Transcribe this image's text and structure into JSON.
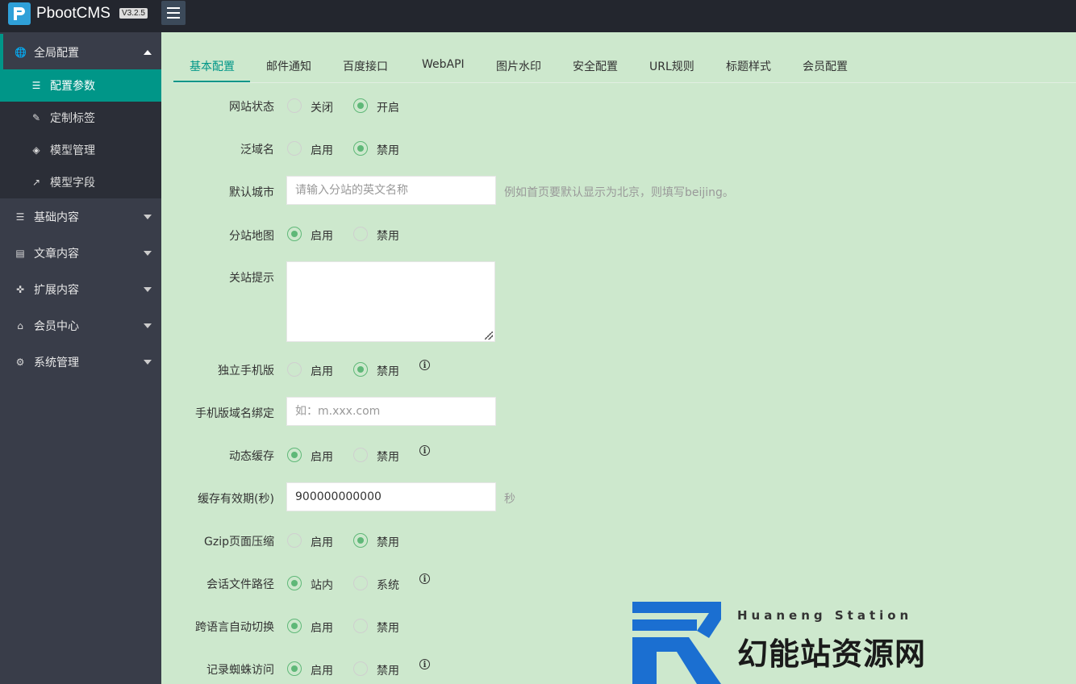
{
  "header": {
    "brand": "PbootCMS",
    "version": "V3.2.5"
  },
  "sidebar": {
    "groups": [
      {
        "label": "全局配置",
        "icon": "globe-icon"
      },
      {
        "label": "基础内容",
        "icon": "sliders-icon"
      },
      {
        "label": "文章内容",
        "icon": "file-icon"
      },
      {
        "label": "扩展内容",
        "icon": "expand-icon"
      },
      {
        "label": "会员中心",
        "icon": "lock-icon"
      },
      {
        "label": "系统管理",
        "icon": "gear-icon"
      }
    ],
    "subitems": [
      {
        "label": "配置参数",
        "icon": "sliders-icon"
      },
      {
        "label": "定制标签",
        "icon": "wrench-icon"
      },
      {
        "label": "模型管理",
        "icon": "cube-icon"
      },
      {
        "label": "模型字段",
        "icon": "external-link-icon"
      }
    ]
  },
  "tabs": [
    "基本配置",
    "邮件通知",
    "百度接口",
    "WebAPI",
    "图片水印",
    "安全配置",
    "URL规则",
    "标题样式",
    "会员配置"
  ],
  "form": {
    "site_status": {
      "label": "网站状态",
      "opt1": "关闭",
      "opt2": "开启"
    },
    "wildcard": {
      "label": "泛域名",
      "opt1": "启用",
      "opt2": "禁用"
    },
    "default_city": {
      "label": "默认城市",
      "placeholder": "请输入分站的英文名称",
      "hint": "例如首页要默认显示为北京，则填写beijing。"
    },
    "sub_map": {
      "label": "分站地图",
      "opt1": "启用",
      "opt2": "禁用"
    },
    "close_tip": {
      "label": "关站提示"
    },
    "mobile": {
      "label": "独立手机版",
      "opt1": "启用",
      "opt2": "禁用"
    },
    "mobile_domain": {
      "label": "手机版域名绑定",
      "placeholder": "如：m.xxx.com"
    },
    "cache": {
      "label": "动态缓存",
      "opt1": "启用",
      "opt2": "禁用"
    },
    "cache_time": {
      "label": "缓存有效期(秒)",
      "value": "900000000000",
      "unit": "秒"
    },
    "gzip": {
      "label": "Gzip页面压缩",
      "opt1": "启用",
      "opt2": "禁用"
    },
    "session_path": {
      "label": "会话文件路径",
      "opt1": "站内",
      "opt2": "系统"
    },
    "lang_switch": {
      "label": "跨语言自动切换",
      "opt1": "启用",
      "opt2": "禁用"
    },
    "spider_log": {
      "label": "记录蜘蛛访问",
      "opt1": "启用",
      "opt2": "禁用"
    }
  },
  "watermark": {
    "small": "Huaneng Station",
    "big": "幻能站资源网"
  },
  "colors": {
    "accent": "#009688",
    "sidebar": "#393d49",
    "topbar": "#23262e",
    "content_bg": "#cde8cd",
    "radio_on": "#5fb878"
  }
}
